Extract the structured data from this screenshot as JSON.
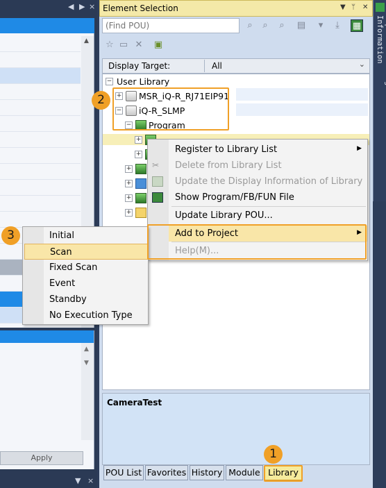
{
  "left_panel": {
    "apply_label": "Apply"
  },
  "element_selection": {
    "title": "Element Selection",
    "find_placeholder": "(Find POU)",
    "display_target_label": "Display Target:",
    "display_target_value": "All",
    "tree": {
      "root": "User Library",
      "library_1": "MSR_iQ-R_RJ71EIP91",
      "library_2": "iQ-R_SLMP",
      "folder_program": "Program",
      "selected_pou": "CameraTest"
    },
    "info_title": "CameraTest",
    "tabs": [
      "POU List",
      "Favorites",
      "History",
      "Module",
      "Library"
    ],
    "active_tab": "Library"
  },
  "side_strip_text": "Input the Configuration Detailed Information",
  "context_menu": {
    "items": [
      {
        "label": "Register to Library List",
        "disabled": false,
        "submenu": true
      },
      {
        "label": "Delete from Library List",
        "disabled": true,
        "submenu": false
      },
      {
        "label": "Update the Display Information of Library",
        "disabled": true,
        "submenu": false
      },
      {
        "label": "Show Program/FB/FUN File",
        "disabled": false,
        "submenu": false
      },
      {
        "label": "Update Library POU...",
        "disabled": false,
        "submenu": false
      },
      {
        "label": "Add to Project",
        "disabled": false,
        "submenu": true
      },
      {
        "label": "Help(M)...",
        "disabled": true,
        "submenu": false
      }
    ]
  },
  "submenu": {
    "items": [
      "Initial",
      "Scan",
      "Fixed Scan",
      "Event",
      "Standby",
      "No Execution Type"
    ],
    "highlighted": "Scan"
  },
  "callouts": [
    "1",
    "2",
    "3"
  ],
  "colors": {
    "callout_orange": "#f0a027",
    "title_yellow": "#f4e9a8",
    "highlight": "#f9e6a8",
    "dark_chrome": "#2b3a55"
  }
}
